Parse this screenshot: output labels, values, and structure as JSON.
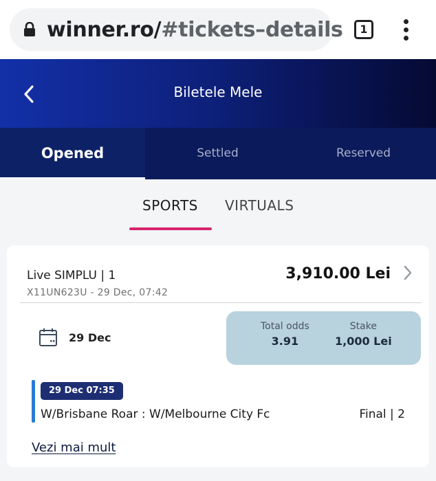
{
  "browser": {
    "url_domain": "winner.ro/",
    "url_path": "#tickets–details",
    "tab_count": "1"
  },
  "header": {
    "title": "Biletele Mele"
  },
  "status_tabs": [
    {
      "label": "Opened",
      "active": true
    },
    {
      "label": "Settled",
      "active": false
    },
    {
      "label": "Reserved",
      "active": false
    }
  ],
  "sub_tabs": [
    {
      "label": "SPORTS",
      "active": true
    },
    {
      "label": "VIRTUALS",
      "active": false
    }
  ],
  "ticket": {
    "type": "Live SIMPLU | 1",
    "id": "X11UN623U - 29 Dec, 07:42",
    "amount": "3,910.00 Lei",
    "date": "29 Dec",
    "total_odds_label": "Total odds",
    "total_odds_value": "3.91",
    "stake_label": "Stake",
    "stake_value": "1,000 Lei",
    "event": {
      "time": "29 Dec 07:35",
      "teams": "W/Brisbane Roar : W/Melbourne City Fc",
      "result": "Final | 2"
    },
    "see_more": "Vezi mai mult"
  },
  "colors": {
    "header_start": "#1330a8",
    "header_end": "#050a33",
    "tabs_bg": "#0a1a5a",
    "accent_underline": "#d6246e",
    "odds_box": "#b8d2de",
    "event_badge": "#1d2e73",
    "event_bar": "#2a7bd4"
  }
}
